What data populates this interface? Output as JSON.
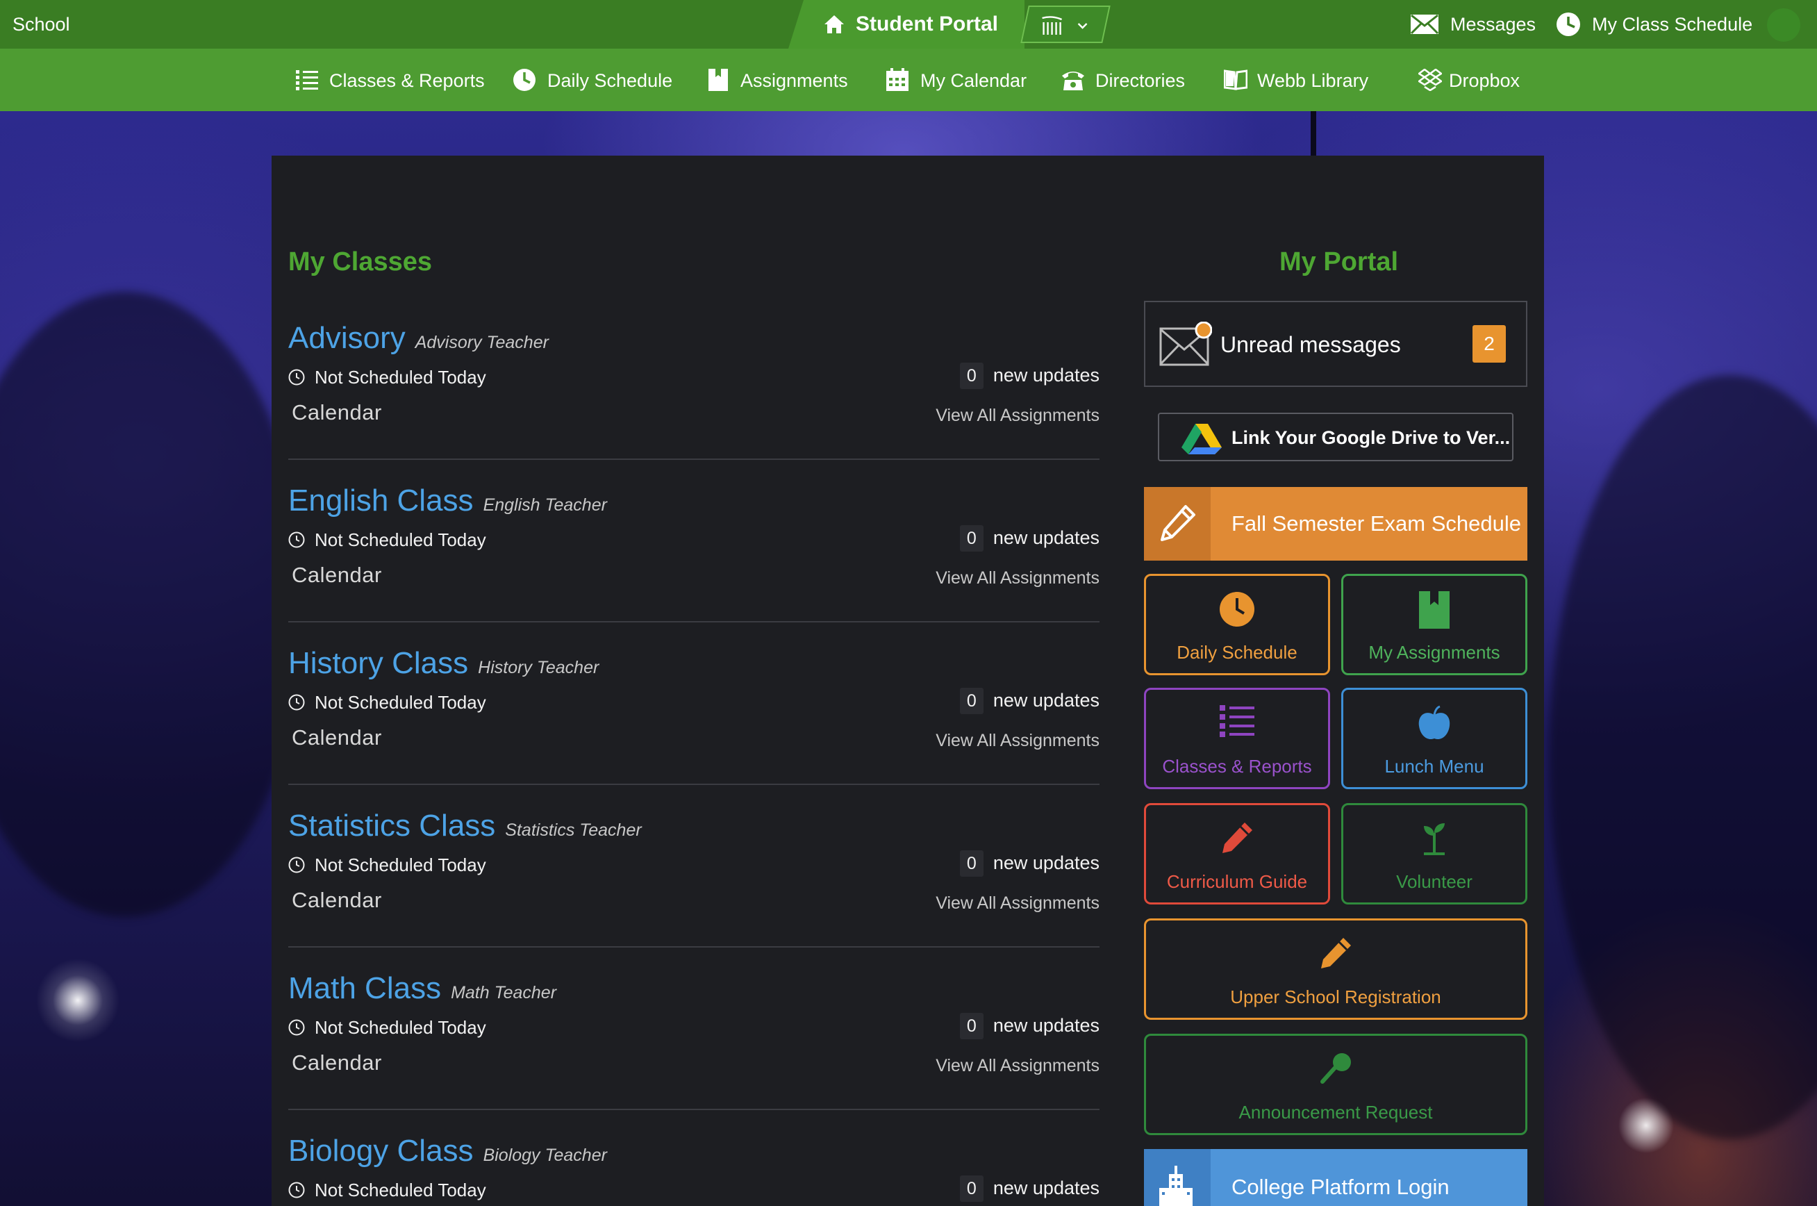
{
  "topbar": {
    "school": "School",
    "portal_label": "Student Portal",
    "messages": "Messages",
    "my_class_schedule": "My Class Schedule"
  },
  "nav": {
    "items": [
      {
        "label": "Classes & Reports",
        "icon": "list-icon"
      },
      {
        "label": "Daily Schedule",
        "icon": "clock-icon"
      },
      {
        "label": "Assignments",
        "icon": "bookmark-icon"
      },
      {
        "label": "My Calendar",
        "icon": "calendar-icon"
      },
      {
        "label": "Directories",
        "icon": "phone-icon"
      },
      {
        "label": "Webb Library",
        "icon": "book-icon"
      },
      {
        "label": "Dropbox",
        "icon": "dropbox-icon"
      }
    ]
  },
  "my_classes": {
    "title": "My Classes",
    "classes": [
      {
        "name": "Advisory",
        "teacher": "Advisory Teacher",
        "schedule": "Not Scheduled Today",
        "updates": "0",
        "updates_label": "new updates",
        "calendar": "Calendar",
        "view_all": "View All Assignments"
      },
      {
        "name": "English Class",
        "teacher": "English Teacher",
        "schedule": "Not Scheduled Today",
        "updates": "0",
        "updates_label": "new updates",
        "calendar": "Calendar",
        "view_all": "View All Assignments"
      },
      {
        "name": "History Class",
        "teacher": "History Teacher",
        "schedule": "Not Scheduled Today",
        "updates": "0",
        "updates_label": "new updates",
        "calendar": "Calendar",
        "view_all": "View All Assignments"
      },
      {
        "name": "Statistics Class",
        "teacher": "Statistics Teacher",
        "schedule": "Not Scheduled Today",
        "updates": "0",
        "updates_label": "new updates",
        "calendar": "Calendar",
        "view_all": "View All Assignments"
      },
      {
        "name": "Math Class",
        "teacher": "Math Teacher",
        "schedule": "Not Scheduled Today",
        "updates": "0",
        "updates_label": "new updates",
        "calendar": "Calendar",
        "view_all": "View All Assignments"
      },
      {
        "name": "Biology Class",
        "teacher": "Biology Teacher",
        "schedule": "Not Scheduled Today",
        "updates": "0",
        "updates_label": "new updates"
      }
    ]
  },
  "my_portal": {
    "title": "My Portal",
    "unread_label": "Unread messages",
    "unread_count": "2",
    "gdrive_label": "Link Your Google Drive to Ver...",
    "fall_exam": "Fall Semester Exam Schedule",
    "tiles": [
      {
        "label": "Daily Schedule",
        "icon": "clock-icon",
        "color": "#e8942f"
      },
      {
        "label": "My Assignments",
        "icon": "bookmark-icon",
        "color": "#3fa34d"
      },
      {
        "label": "Classes & Reports",
        "icon": "list-icon",
        "color": "#8e44c0"
      },
      {
        "label": "Lunch Menu",
        "icon": "apple-icon",
        "color": "#3d8fd6"
      },
      {
        "label": "Curriculum Guide",
        "icon": "pencil-icon",
        "color": "#e04a3a"
      },
      {
        "label": "Volunteer",
        "icon": "sprout-icon",
        "color": "#2f8a3c"
      },
      {
        "label": "Upper School Registration",
        "icon": "pencil-icon",
        "color": "#e8942f"
      },
      {
        "label": "Announcement Request",
        "icon": "microphone-icon",
        "color": "#2f8a3c"
      }
    ],
    "college_login": "College Platform Login"
  },
  "colors": {
    "topbar": "#3a7d23",
    "navbar": "#4e9c32",
    "panel": "#1d1e22",
    "class_link": "#4da3e6",
    "section_title": "#4ea733",
    "orange": "#e8942f",
    "college_blue": "#4f95d9"
  }
}
